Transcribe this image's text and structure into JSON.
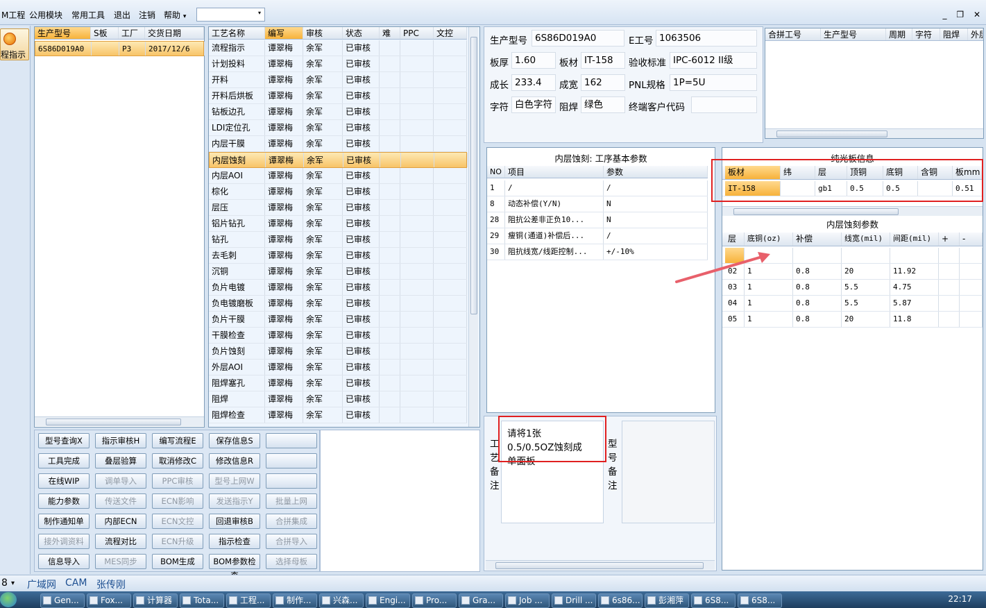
{
  "menu": {
    "items": [
      "M工程",
      "公用模块",
      "常用工具",
      "退出",
      "注销",
      "帮助"
    ],
    "help_arrow": "▾",
    "dropdown_value": "",
    "dropdown_arrow": "▾"
  },
  "window_controls": {
    "min": "_",
    "restore": "❐",
    "close": "✕"
  },
  "left_strip": {
    "label": "程指示"
  },
  "models": {
    "columns": [
      "生产型号",
      "S板",
      "工厂",
      "交货日期"
    ],
    "rows": [
      {
        "model": "6S86D019A0",
        "s": "",
        "factory": "P3",
        "date": "2017/12/6"
      }
    ]
  },
  "processes": {
    "columns": [
      "工艺名称",
      "编写",
      "审核",
      "状态",
      "难",
      "PPC",
      "文控"
    ],
    "rows": [
      [
        "流程指示",
        "谭翠梅",
        "余军",
        "已审核"
      ],
      [
        "计划投料",
        "谭翠梅",
        "余军",
        "已审核"
      ],
      [
        "开料",
        "谭翠梅",
        "余军",
        "已审核"
      ],
      [
        "开料后烘板",
        "谭翠梅",
        "余军",
        "已审核"
      ],
      [
        "钻板边孔",
        "谭翠梅",
        "余军",
        "已审核"
      ],
      [
        "LDI定位孔",
        "谭翠梅",
        "余军",
        "已审核"
      ],
      [
        "内层干膜",
        "谭翠梅",
        "余军",
        "已审核"
      ],
      [
        "内层蚀刻",
        "谭翠梅",
        "余军",
        "已审核"
      ],
      [
        "内层AOI",
        "谭翠梅",
        "余军",
        "已审核"
      ],
      [
        "棕化",
        "谭翠梅",
        "余军",
        "已审核"
      ],
      [
        "层压",
        "谭翠梅",
        "余军",
        "已审核"
      ],
      [
        "铝片钻孔",
        "谭翠梅",
        "余军",
        "已审核"
      ],
      [
        "钻孔",
        "谭翠梅",
        "余军",
        "已审核"
      ],
      [
        "去毛刺",
        "谭翠梅",
        "余军",
        "已审核"
      ],
      [
        "沉铜",
        "谭翠梅",
        "余军",
        "已审核"
      ],
      [
        "负片电镀",
        "谭翠梅",
        "余军",
        "已审核"
      ],
      [
        "负电镀磨板",
        "谭翠梅",
        "余军",
        "已审核"
      ],
      [
        "负片干膜",
        "谭翠梅",
        "余军",
        "已审核"
      ],
      [
        "干膜检查",
        "谭翠梅",
        "余军",
        "已审核"
      ],
      [
        "负片蚀刻",
        "谭翠梅",
        "余军",
        "已审核"
      ],
      [
        "外层AOI",
        "谭翠梅",
        "余军",
        "已审核"
      ],
      [
        "阻焊塞孔",
        "谭翠梅",
        "余军",
        "已审核"
      ],
      [
        "阻焊",
        "谭翠梅",
        "余军",
        "已审核"
      ],
      [
        "阻焊检查",
        "谭翠梅",
        "余军",
        "已审核"
      ]
    ],
    "selected_index": 7
  },
  "buttons": [
    [
      "型号查询X",
      "指示审核H",
      "编写流程E",
      "保存信息S",
      ""
    ],
    [
      "工具完成",
      "叠层验算",
      "取消修改C",
      "修改信息R",
      ""
    ],
    [
      "在线WIP",
      "调单导入",
      "PPC审核",
      "型号上网W",
      ""
    ],
    [
      "能力参数",
      "传送文件",
      "ECN影响",
      "发送指示Y",
      "批量上网"
    ],
    [
      "制作通知单",
      "内部ECN",
      "ECN文控",
      "回退审核B",
      "合拼集成"
    ],
    [
      "接外调资料",
      "流程对比",
      "ECN升级",
      "指示检查",
      "合拼导入"
    ],
    [
      "信息导入",
      "MES同步",
      "BOM生成",
      "BOM参数检查",
      "选择母板"
    ]
  ],
  "disabled_buttons": [
    "调单导入",
    "PPC审核",
    "型号上网W",
    "传送文件",
    "ECN影响",
    "发送指示Y",
    "批量上网",
    "ECN文控",
    "合拼集成",
    "接外调资料",
    "ECN升级",
    "合拼导入",
    "MES同步",
    "选择母板"
  ],
  "info": {
    "model_label": "生产型号",
    "model": "6S86D019A0",
    "e_label": "E工号",
    "e_no": "1063506",
    "thick_label": "板厚",
    "thick": "1.60",
    "mat_label": "板材",
    "mat": "IT-158",
    "std_label": "验收标准",
    "std": "IPC-6012 II级",
    "len_label": "成长",
    "len": "233.4",
    "wid_label": "成宽",
    "wid": "162",
    "pnl_label": "PNL规格",
    "pnl": "1P=5U",
    "char_label": "字符",
    "char": "白色字符",
    "mask_label": "阻焊",
    "mask": "绿色",
    "cust_label": "终端客户代码",
    "cust": ""
  },
  "merge": {
    "columns": [
      "合拼工号",
      "生产型号",
      "周期",
      "字符",
      "阻焊",
      "外层"
    ]
  },
  "params": {
    "title": "内层蚀刻: 工序基本参数",
    "columns": [
      "NO",
      "项目",
      "参数"
    ],
    "rows": [
      [
        "1",
        "/",
        "/"
      ],
      [
        "8",
        "动态补偿(Y/N)",
        "N"
      ],
      [
        "28",
        "阻抗公差非正负10...",
        "N"
      ],
      [
        "29",
        "瘦铜(通道)补偿后...",
        "/"
      ],
      [
        "30",
        "阻抗线宽/线距控制...",
        "+/-10%"
      ]
    ]
  },
  "plain_board": {
    "title": "纯光板信息",
    "columns": [
      "板材",
      "纬",
      "层",
      "顶铜",
      "底铜",
      "含铜",
      "板mm"
    ],
    "row": [
      "IT-158",
      "",
      "gb1",
      "0.5",
      "0.5",
      "",
      "0.51"
    ]
  },
  "etch": {
    "title": "内层蚀刻参数",
    "columns": [
      "层",
      "底铜(oz)",
      "补偿",
      "线宽(mil)",
      "间距(mil)",
      "+",
      "-"
    ],
    "rows": [
      [
        "",
        "",
        "",
        "",
        "",
        "",
        ""
      ],
      [
        "02",
        "1",
        "0.8",
        "20",
        "11.92",
        "",
        ""
      ],
      [
        "03",
        "1",
        "0.8",
        "5.5",
        "4.75",
        "",
        ""
      ],
      [
        "04",
        "1",
        "0.8",
        "5.5",
        "5.87",
        "",
        ""
      ],
      [
        "05",
        "1",
        "0.8",
        "20",
        "11.8",
        "",
        ""
      ]
    ]
  },
  "notes": {
    "process_label": [
      "工",
      "艺",
      "备",
      "注"
    ],
    "process_note": "请将1张0.5/0.5OZ蚀刻成单面板",
    "model_label": [
      "型",
      "号",
      "备",
      "注"
    ]
  },
  "status": {
    "a": "8",
    "b": "广域网",
    "c": "CAM",
    "d": "张传刚"
  },
  "taskbar": {
    "items": [
      "Gen...",
      "Fox...",
      "计算器",
      "Tota...",
      "工程...",
      "制作...",
      "兴森...",
      "Engi...",
      "Pro...",
      "Gra...",
      "Job ...",
      "Drill ...",
      "6s86...",
      "彭湘萍",
      "6S8...",
      "6S8..."
    ],
    "clock": "22:17"
  },
  "colors": {
    "accent_orange": "#f7b23a",
    "annotation_red": "#e02020"
  }
}
